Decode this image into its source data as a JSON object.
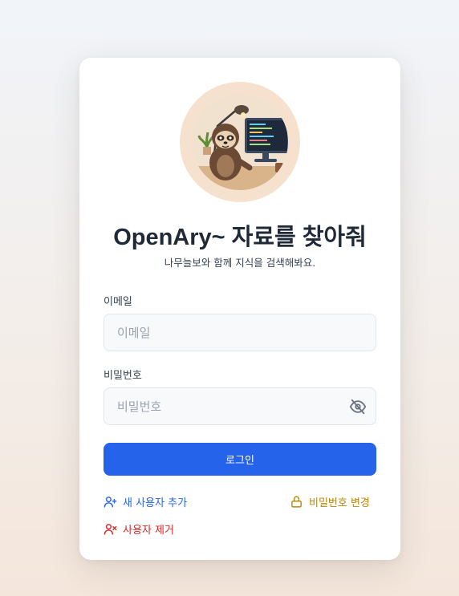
{
  "header": {
    "title": "OpenAry~ 자료를 찾아줘",
    "subtitle": "나무늘보와 함께 지식을 검색해봐요."
  },
  "form": {
    "email_label": "이메일",
    "email_placeholder": "이메일",
    "email_value": "",
    "password_label": "비밀번호",
    "password_placeholder": "비밀번호",
    "password_value": "",
    "login_label": "로그인"
  },
  "links": {
    "add_user": "새 사용자 추가",
    "change_password": "비밀번호 변경",
    "remove_user": "사용자 제거"
  },
  "icons": {
    "avatar": "sloth-avatar",
    "password_toggle": "eye-off-icon",
    "add_user": "user-plus-icon",
    "change_password": "lock-icon",
    "remove_user": "user-x-icon"
  },
  "colors": {
    "primary": "#2563eb",
    "warning": "#b8860b",
    "danger": "#dc2626"
  }
}
